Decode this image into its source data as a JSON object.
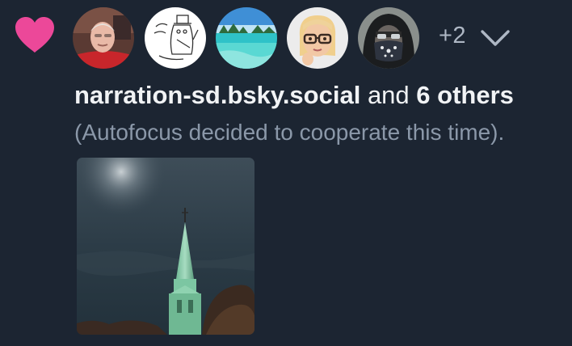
{
  "notification": {
    "type_icon": "heart-icon",
    "accent_color": "#ec4899",
    "avatars": [
      {
        "name": "avatar-older-man-icon"
      },
      {
        "name": "avatar-sketch-drawing-icon"
      },
      {
        "name": "avatar-tropical-beach-icon"
      },
      {
        "name": "avatar-memoji-glasses-icon"
      },
      {
        "name": "avatar-masked-hooded-icon"
      }
    ],
    "more_count": "+2",
    "expand_icon": "chevron-down-icon",
    "actor": "narration-sd.bsky.social",
    "connector": " and ",
    "others": "6 others",
    "post_snippet": "(Autofocus decided to cooperate this time).",
    "image_alt": "church-spire-photo"
  },
  "colors": {
    "background": "#1c2532",
    "primary_text": "#f1f3f5",
    "secondary_text": "#8b98a9"
  }
}
